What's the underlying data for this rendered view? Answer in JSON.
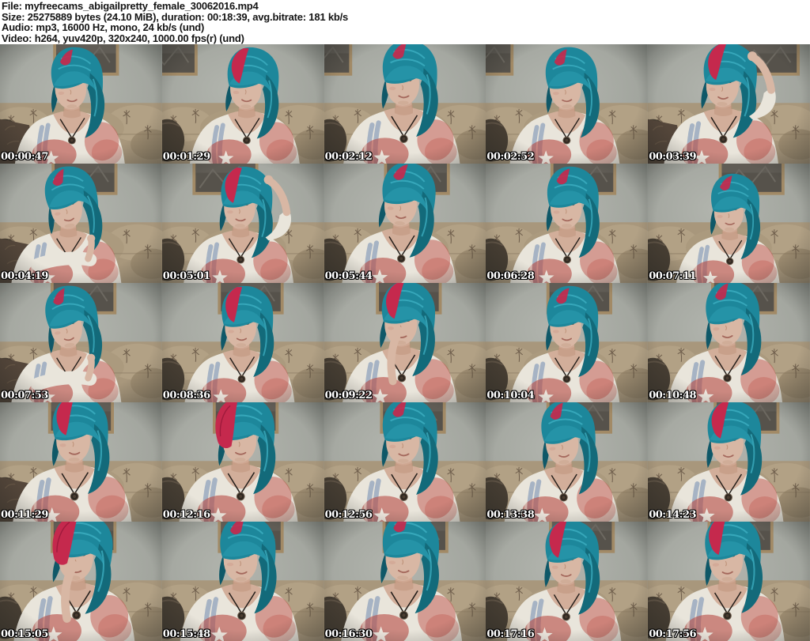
{
  "header": {
    "lines": [
      "File: myfreecams_abigailpretty_female_30062016.mp4",
      "Size: 25275889 bytes (24.10 MiB), duration: 00:18:39, avg.bitrate: 181 kb/s",
      "Audio: mp3, 16000 Hz, mono, 24 kb/s (und)",
      "Video: h264, yuv420p, 320x240, 1000.00 fps(r) (und)"
    ]
  },
  "grid": {
    "columns": 5,
    "rows": 5,
    "source_frame_width": 320,
    "source_frame_height": 240
  },
  "colors": {
    "header_bg": "#ffffff",
    "header_text": "#141414",
    "timestamp_text": "#ffffff",
    "timestamp_outline": "#000000",
    "wall_center": "#b2b5ae",
    "wall_edge": "#7d817a",
    "frame_border": "#a28a66",
    "frame_photo": "#56524b",
    "couch": "#a8977c",
    "couch_light": "#b2a185",
    "couch_pattern": "#5f4f3e",
    "pillow_dark": "#473e33",
    "chair_dark": "#54463a",
    "skin": "#d8b7a4",
    "skin_shadow": "#bd9178",
    "hair_teal": "#1d879b",
    "hair_teal_dark": "#136a7a",
    "hair_teal_light": "#3fb2c4",
    "hair_red": "#c5294d",
    "shirt": "#e9e5db",
    "print_blue": "#6f8bb0",
    "print_red": "#c0544b",
    "star_white": "#f4f1e8",
    "pendant": "#2e2720"
  },
  "thumbnails": [
    {
      "timestamp": "00:00:47",
      "scene": {
        "px": -15,
        "s": 1.0,
        "tilt": -2,
        "hair": "teal",
        "arm": "none",
        "look": "down",
        "frameX": 105
      }
    },
    {
      "timestamp": "00:01:29",
      "scene": {
        "px": 10,
        "s": 1.0,
        "tilt": 2,
        "hair": "split",
        "arm": "none",
        "look": "down",
        "frameX": -60
      }
    },
    {
      "timestamp": "00:02:12",
      "scene": {
        "px": 0,
        "s": 1.06,
        "tilt": 0,
        "hair": "teal",
        "arm": "none",
        "look": "front",
        "frameX": -75
      }
    },
    {
      "timestamp": "00:02:52",
      "scene": {
        "px": 3,
        "s": 1.0,
        "tilt": -3,
        "hair": "teal",
        "arm": "none",
        "look": "down",
        "frameX": -75
      }
    },
    {
      "timestamp": "00:03:39",
      "scene": {
        "px": -8,
        "s": 1.04,
        "tilt": 3,
        "hair": "split",
        "arm": "up",
        "look": "front",
        "frameX": 170
      }
    },
    {
      "timestamp": "00:04:19",
      "scene": {
        "px": -22,
        "s": 1.0,
        "tilt": -9,
        "hair": "teal",
        "arm": "cross",
        "look": "front",
        "frameX": 102
      }
    },
    {
      "timestamp": "00:05:01",
      "scene": {
        "px": -2,
        "s": 1.0,
        "tilt": 1,
        "hair": "split",
        "arm": "up",
        "look": "front",
        "frameX": 60
      }
    },
    {
      "timestamp": "00:05:44",
      "scene": {
        "px": -5,
        "s": 1.04,
        "tilt": 5,
        "hair": "teal",
        "arm": "none",
        "look": "down",
        "frameX": 118
      }
    },
    {
      "timestamp": "00:06:28",
      "scene": {
        "px": 4,
        "s": 1.0,
        "tilt": 0,
        "hair": "teal",
        "arm": "none",
        "look": "front",
        "frameX": 128
      }
    },
    {
      "timestamp": "00:07:11",
      "scene": {
        "px": 5,
        "s": 0.94,
        "tilt": 0,
        "hair": "teal",
        "arm": "none",
        "look": "front",
        "frameX": 140
      }
    },
    {
      "timestamp": "00:07:53",
      "scene": {
        "px": -22,
        "s": 1.0,
        "tilt": -8,
        "hair": "teal",
        "arm": "cross",
        "look": "front",
        "frameX": 100
      }
    },
    {
      "timestamp": "00:08:36",
      "scene": {
        "px": 0,
        "s": 1.0,
        "tilt": 0,
        "hair": "split",
        "arm": "none",
        "look": "front",
        "frameX": 110
      }
    },
    {
      "timestamp": "00:09:22",
      "scene": {
        "px": -4,
        "s": 1.04,
        "tilt": 2,
        "hair": "split",
        "arm": "neck",
        "look": "front",
        "frameX": 102
      }
    },
    {
      "timestamp": "00:10:04",
      "scene": {
        "px": 3,
        "s": 1.0,
        "tilt": 0,
        "hair": "teal",
        "arm": "none",
        "look": "front",
        "frameX": 120
      }
    },
    {
      "timestamp": "00:10:48",
      "scene": {
        "px": 0,
        "s": 1.04,
        "tilt": -2,
        "hair": "teal",
        "arm": "none",
        "look": "front",
        "frameX": 125
      }
    },
    {
      "timestamp": "00:11:29",
      "scene": {
        "px": -10,
        "s": 1.08,
        "tilt": -1,
        "hair": "split",
        "arm": "none",
        "look": "down",
        "frameX": 95
      }
    },
    {
      "timestamp": "00:12:16",
      "scene": {
        "px": -2,
        "s": 1.08,
        "tilt": 0,
        "hair": "red",
        "arm": "none",
        "look": "front",
        "frameX": 100
      }
    },
    {
      "timestamp": "00:12:56",
      "scene": {
        "px": 0,
        "s": 1.06,
        "tilt": 0,
        "hair": "teal",
        "arm": "none",
        "look": "front",
        "frameX": 110
      }
    },
    {
      "timestamp": "00:13:38",
      "scene": {
        "px": -3,
        "s": 1.04,
        "tilt": -4,
        "hair": "teal",
        "arm": "none",
        "look": "down",
        "frameX": 120
      }
    },
    {
      "timestamp": "00:14:23",
      "scene": {
        "px": 2,
        "s": 1.04,
        "tilt": 0,
        "hair": "split",
        "arm": "none",
        "look": "front",
        "frameX": 130
      }
    },
    {
      "timestamp": "00:15:05",
      "scene": {
        "px": -6,
        "s": 1.1,
        "tilt": 5,
        "hair": "red",
        "arm": "neck",
        "look": "side",
        "frameX": 100
      }
    },
    {
      "timestamp": "00:15:48",
      "scene": {
        "px": 0,
        "s": 1.08,
        "tilt": 0,
        "hair": "teal",
        "arm": "none",
        "look": "front",
        "frameX": 110
      }
    },
    {
      "timestamp": "00:16:30",
      "scene": {
        "px": 0,
        "s": 1.1,
        "tilt": 2,
        "hair": "teal",
        "arm": "none",
        "look": "down",
        "frameX": 115
      }
    },
    {
      "timestamp": "00:17:16",
      "scene": {
        "px": 2,
        "s": 1.04,
        "tilt": 0,
        "hair": "split",
        "arm": "none",
        "look": "front",
        "frameX": 125
      }
    },
    {
      "timestamp": "00:17:56",
      "scene": {
        "px": 0,
        "s": 1.08,
        "tilt": -2,
        "hair": "split",
        "arm": "none",
        "look": "front",
        "frameX": 118
      }
    }
  ]
}
